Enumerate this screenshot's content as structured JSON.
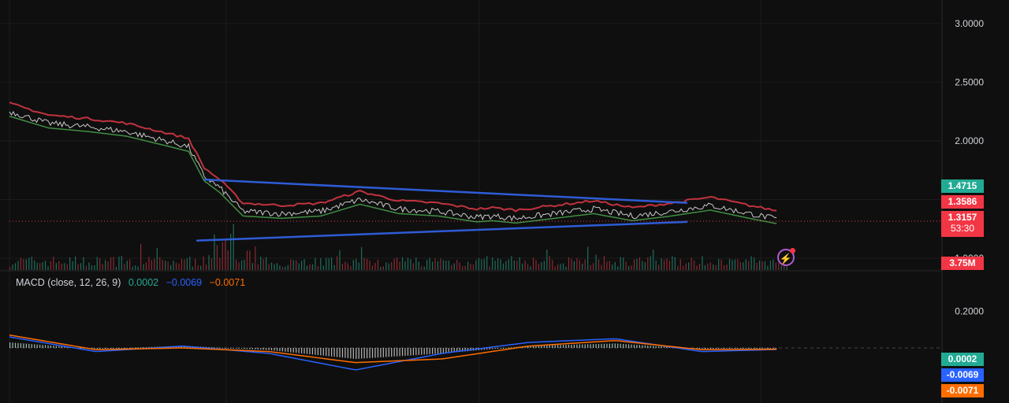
{
  "price_axis": {
    "ticks": [
      "3.0000",
      "2.5000",
      "2.0000",
      "1.0000"
    ],
    "tick_values": [
      3.0,
      2.5,
      2.0,
      1.0
    ]
  },
  "macd_axis": {
    "ticks": [
      "0.2000"
    ],
    "tick_values": [
      0.2
    ]
  },
  "badges": {
    "upper_trendline": "1.4715",
    "lower_band": "1.3586",
    "last_price": "1.3157",
    "countdown": "53:30",
    "volume": "3.75M",
    "macd_hist": "0.0002",
    "macd_line": "-0.0069",
    "macd_signal": "-0.0071"
  },
  "macd_legend": {
    "title": "MACD (close, 12, 26, 9)",
    "hist": "0.0002",
    "macd": "−0.0069",
    "signal": "−0.0071"
  },
  "colors": {
    "background": "#0f0f0f",
    "trendline": "#2e5cd6",
    "supertrend_down": "#c0333f",
    "supertrend_up": "#4caf50",
    "badge_green": "#22ab94",
    "badge_red": "#f23645",
    "badge_blue": "#2962ff",
    "badge_orange": "#ff6d00",
    "macd_line": "#2962ff",
    "signal_line": "#ff6d00"
  },
  "chart_data": [
    {
      "type": "line",
      "title": "",
      "description_series": "price",
      "x": [
        0,
        5,
        10,
        15,
        20,
        23,
        25,
        27,
        30,
        35,
        40,
        45,
        50,
        55,
        60,
        62,
        65,
        70,
        75,
        80,
        85,
        90,
        95,
        100
      ],
      "series": [
        {
          "values": [
            2.25,
            2.15,
            2.12,
            2.08,
            2.0,
            1.95,
            1.7,
            1.6,
            1.4,
            1.38,
            1.4,
            1.5,
            1.42,
            1.4,
            1.35,
            1.36,
            1.34,
            1.38,
            1.42,
            1.36,
            1.4,
            1.45,
            1.38,
            1.3157
          ]
        }
      ],
      "ylim": [
        0.9,
        3.2
      ],
      "trendlines": [
        {
          "x": [
            25,
            84
          ],
          "y": [
            1.67,
            1.4715
          ]
        },
        {
          "x": [
            24,
            84
          ],
          "y": [
            1.15,
            1.31
          ]
        }
      ],
      "current_price": 1.3157
    },
    {
      "type": "bar",
      "title": "MACD (close, 12, 26, 9)",
      "legend": [
        "0.0002",
        "−0.0069",
        "−0.0071"
      ],
      "ylim": [
        -0.3,
        0.3
      ],
      "series": [
        {
          "values": [
            0.05,
            -0.01,
            0.02,
            -0.02,
            -0.1,
            -0.05,
            0.02,
            0.04,
            -0.01,
            0.0002
          ]
        },
        {
          "values": [
            0.06,
            -0.02,
            0.01,
            -0.03,
            -0.12,
            -0.03,
            0.03,
            0.05,
            -0.02,
            -0.0069
          ]
        },
        {
          "values": [
            0.07,
            -0.01,
            0.0,
            -0.02,
            -0.08,
            -0.06,
            0.01,
            0.04,
            -0.01,
            -0.0071
          ]
        }
      ]
    }
  ]
}
